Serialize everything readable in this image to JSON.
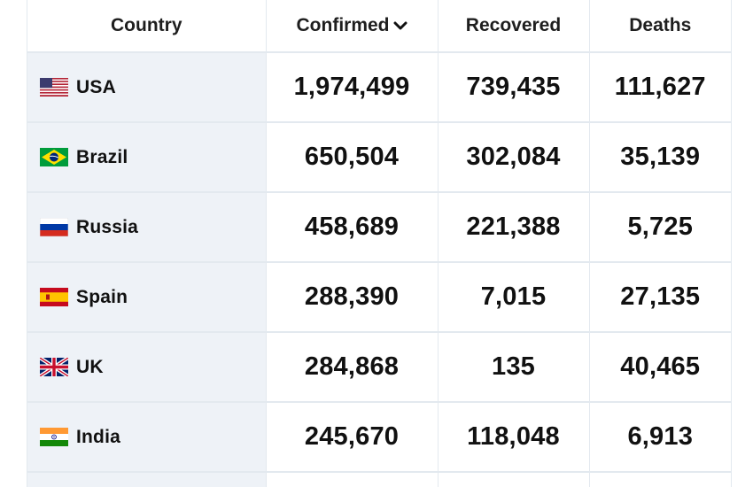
{
  "table": {
    "headers": {
      "country": "Country",
      "confirmed": "Confirmed",
      "recovered": "Recovered",
      "deaths": "Deaths"
    },
    "sort": {
      "column": "confirmed",
      "direction": "descending",
      "icon": "chevron-down-icon"
    },
    "rows": [
      {
        "country": "USA",
        "flag": "usa-flag-icon",
        "confirmed": "1,974,499",
        "recovered": "739,435",
        "deaths": "111,627"
      },
      {
        "country": "Brazil",
        "flag": "brazil-flag-icon",
        "confirmed": "650,504",
        "recovered": "302,084",
        "deaths": "35,139"
      },
      {
        "country": "Russia",
        "flag": "russia-flag-icon",
        "confirmed": "458,689",
        "recovered": "221,388",
        "deaths": "5,725"
      },
      {
        "country": "Spain",
        "flag": "spain-flag-icon",
        "confirmed": "288,390",
        "recovered": "7,015",
        "deaths": "27,135"
      },
      {
        "country": "UK",
        "flag": "uk-flag-icon",
        "confirmed": "284,868",
        "recovered": "135",
        "deaths": "40,465"
      },
      {
        "country": "India",
        "flag": "india-flag-icon",
        "confirmed": "245,670",
        "recovered": "118,048",
        "deaths": "6,913"
      }
    ]
  },
  "colors": {
    "country_column_bg": "#eef2f7",
    "grid_line": "#e3e9ef",
    "text": "#111111"
  }
}
